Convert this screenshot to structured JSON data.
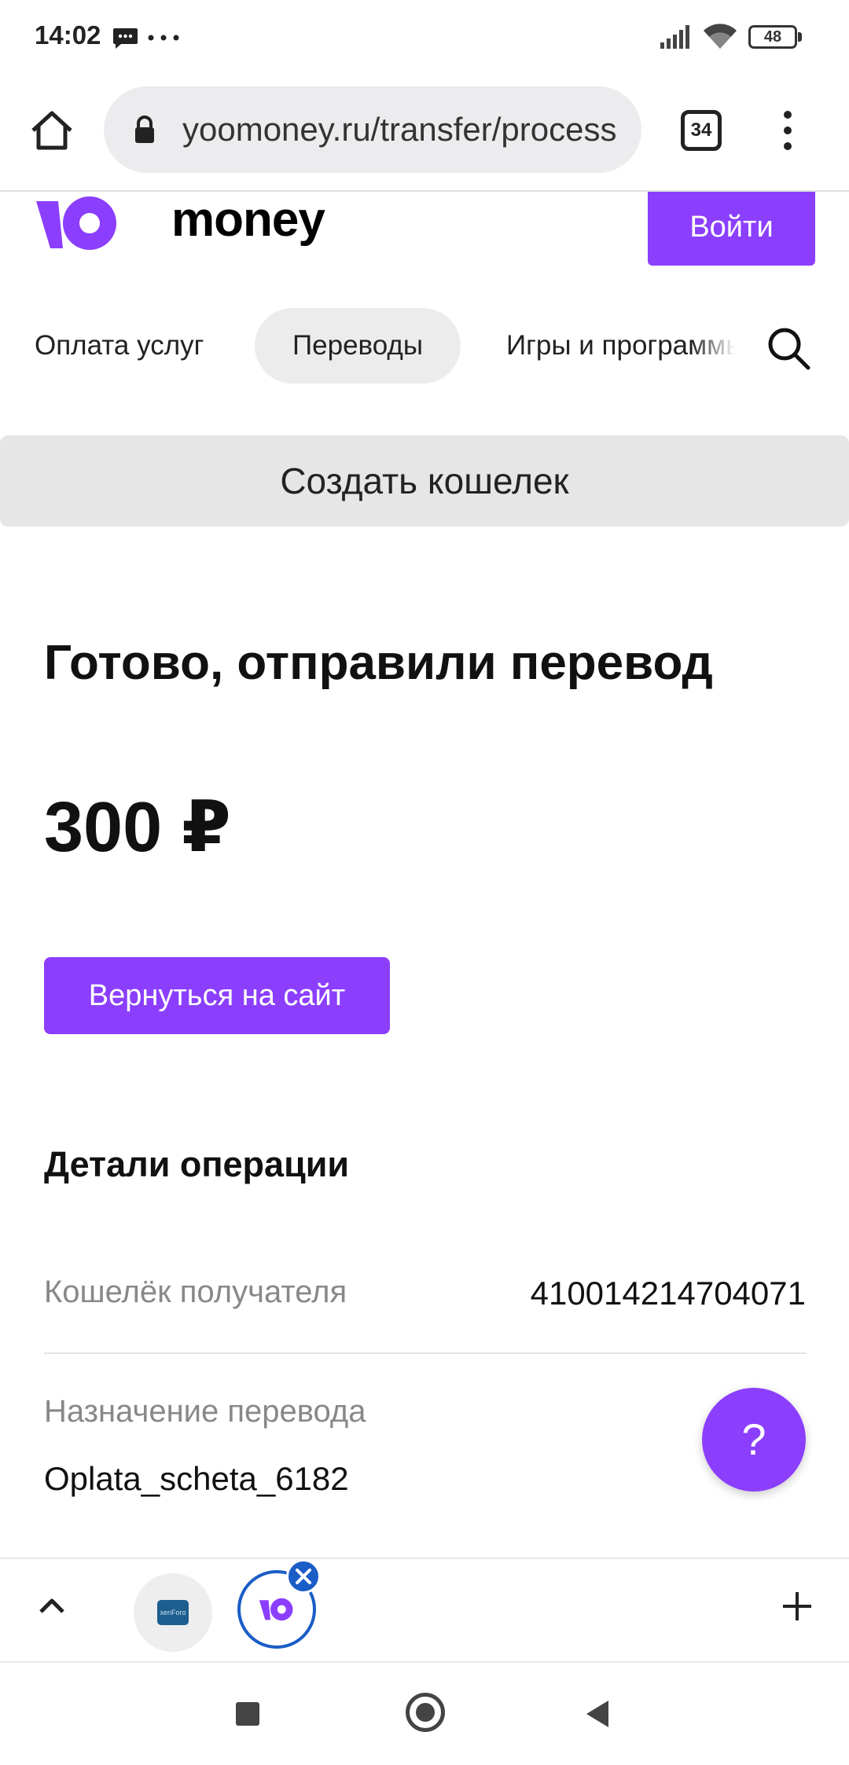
{
  "status_bar": {
    "time": "14:02",
    "battery": "48"
  },
  "browser": {
    "url": "yoomoney.ru/transfer/process",
    "tab_count": "34"
  },
  "site": {
    "logo_text": "money",
    "login_label": "Войти",
    "nav": [
      "Оплата услуг",
      "Переводы",
      "Игры и программы"
    ],
    "create_wallet_label": "Создать кошелек"
  },
  "main": {
    "title": "Готово, отправили перевод",
    "amount": "300 ₽",
    "back_button": "Вернуться на сайт",
    "details_title": "Детали операции",
    "rows": [
      {
        "label": "Кошелёк получателя",
        "value": "410014214704071"
      },
      {
        "label": "Назначение перевода",
        "value": "Oplata_scheta_6182"
      }
    ],
    "help_label": "?"
  },
  "tab_strip": {
    "thumb1_label": "xenForo"
  },
  "colors": {
    "accent": "#8b3ffd",
    "tab_selected": "#1a5dc6"
  }
}
